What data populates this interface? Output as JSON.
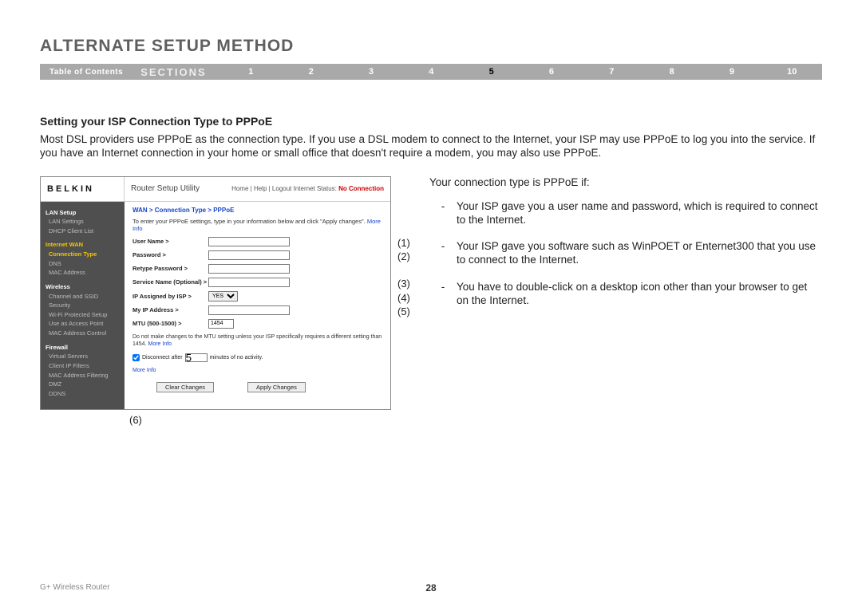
{
  "header": {
    "title": "ALTERNATE SETUP METHOD",
    "toc": "Table of Contents",
    "sections_label": "SECTIONS",
    "sections": [
      "1",
      "2",
      "3",
      "4",
      "5",
      "6",
      "7",
      "8",
      "9",
      "10"
    ],
    "selected": "5"
  },
  "body": {
    "subheading": "Setting your ISP Connection Type to PPPoE",
    "intro": "Most DSL providers use PPPoE as the connection type. If you use a DSL modem to connect to the Internet, your ISP may use PPPoE to log you into the service. If you have an Internet connection in your home or small office that doesn't require a modem, you may also use PPPoE."
  },
  "screenshot": {
    "logo": "BELKIN",
    "utility": "Router Setup Utility",
    "toplinks": "Home | Help | Logout   Internet Status:",
    "status": "No Connection",
    "sidebar": {
      "g1": "LAN Setup",
      "g1a": "LAN Settings",
      "g1b": "DHCP Client List",
      "g2": "Internet WAN",
      "g2a": "Connection Type",
      "g2b": "DNS",
      "g2c": "MAC Address",
      "g3": "Wireless",
      "g3a": "Channel and SSID",
      "g3b": "Security",
      "g3c": "Wi-Fi Protected Setup",
      "g3d": "Use as Access Point",
      "g3e": "MAC Address Control",
      "g4": "Firewall",
      "g4a": "Virtual Servers",
      "g4b": "Client IP Filters",
      "g4c": "MAC Address Filtering",
      "g4d": "DMZ",
      "g4e": "DDNS"
    },
    "breadcrumb": "WAN > Connection Type > PPPoE",
    "instr": "To enter your PPPoE settings, type in your information below and click \"Apply changes\".",
    "moreinfo": "More Info",
    "rows": {
      "user": "User Name >",
      "pass": "Password >",
      "retype": "Retype Password >",
      "service": "Service Name (Optional) >",
      "ipassigned": "IP Assigned by ISP >",
      "ipassigned_val": "YES",
      "myip": "My IP Address >",
      "mtu": "MTU (500-1500) >",
      "mtu_val": "1454"
    },
    "note": "Do not make changes to the MTU setting unless your ISP specifically requires a different setting than 1454.",
    "disconnect_pre": "Disconnect after",
    "disconnect_val": "5",
    "disconnect_post": "minutes of no activity.",
    "btn_clear": "Clear Changes",
    "btn_apply": "Apply Changes"
  },
  "annotations": {
    "a1": "(1)",
    "a2": "(2)",
    "a3": "(3)",
    "a4": "(4)",
    "a5": "(5)",
    "a6": "(6)"
  },
  "right": {
    "lead": "Your connection type is PPPoE if:",
    "dash": "-",
    "b1": "Your ISP gave you a user name and password, which is required to connect to the Internet.",
    "b2": "Your ISP gave you software such as WinPOET or Enternet300 that you use to connect to the Internet.",
    "b3": "You have to double-click on a desktop icon other than your browser to get on the Internet."
  },
  "footer": {
    "product": "G+ Wireless Router",
    "page": "28"
  }
}
